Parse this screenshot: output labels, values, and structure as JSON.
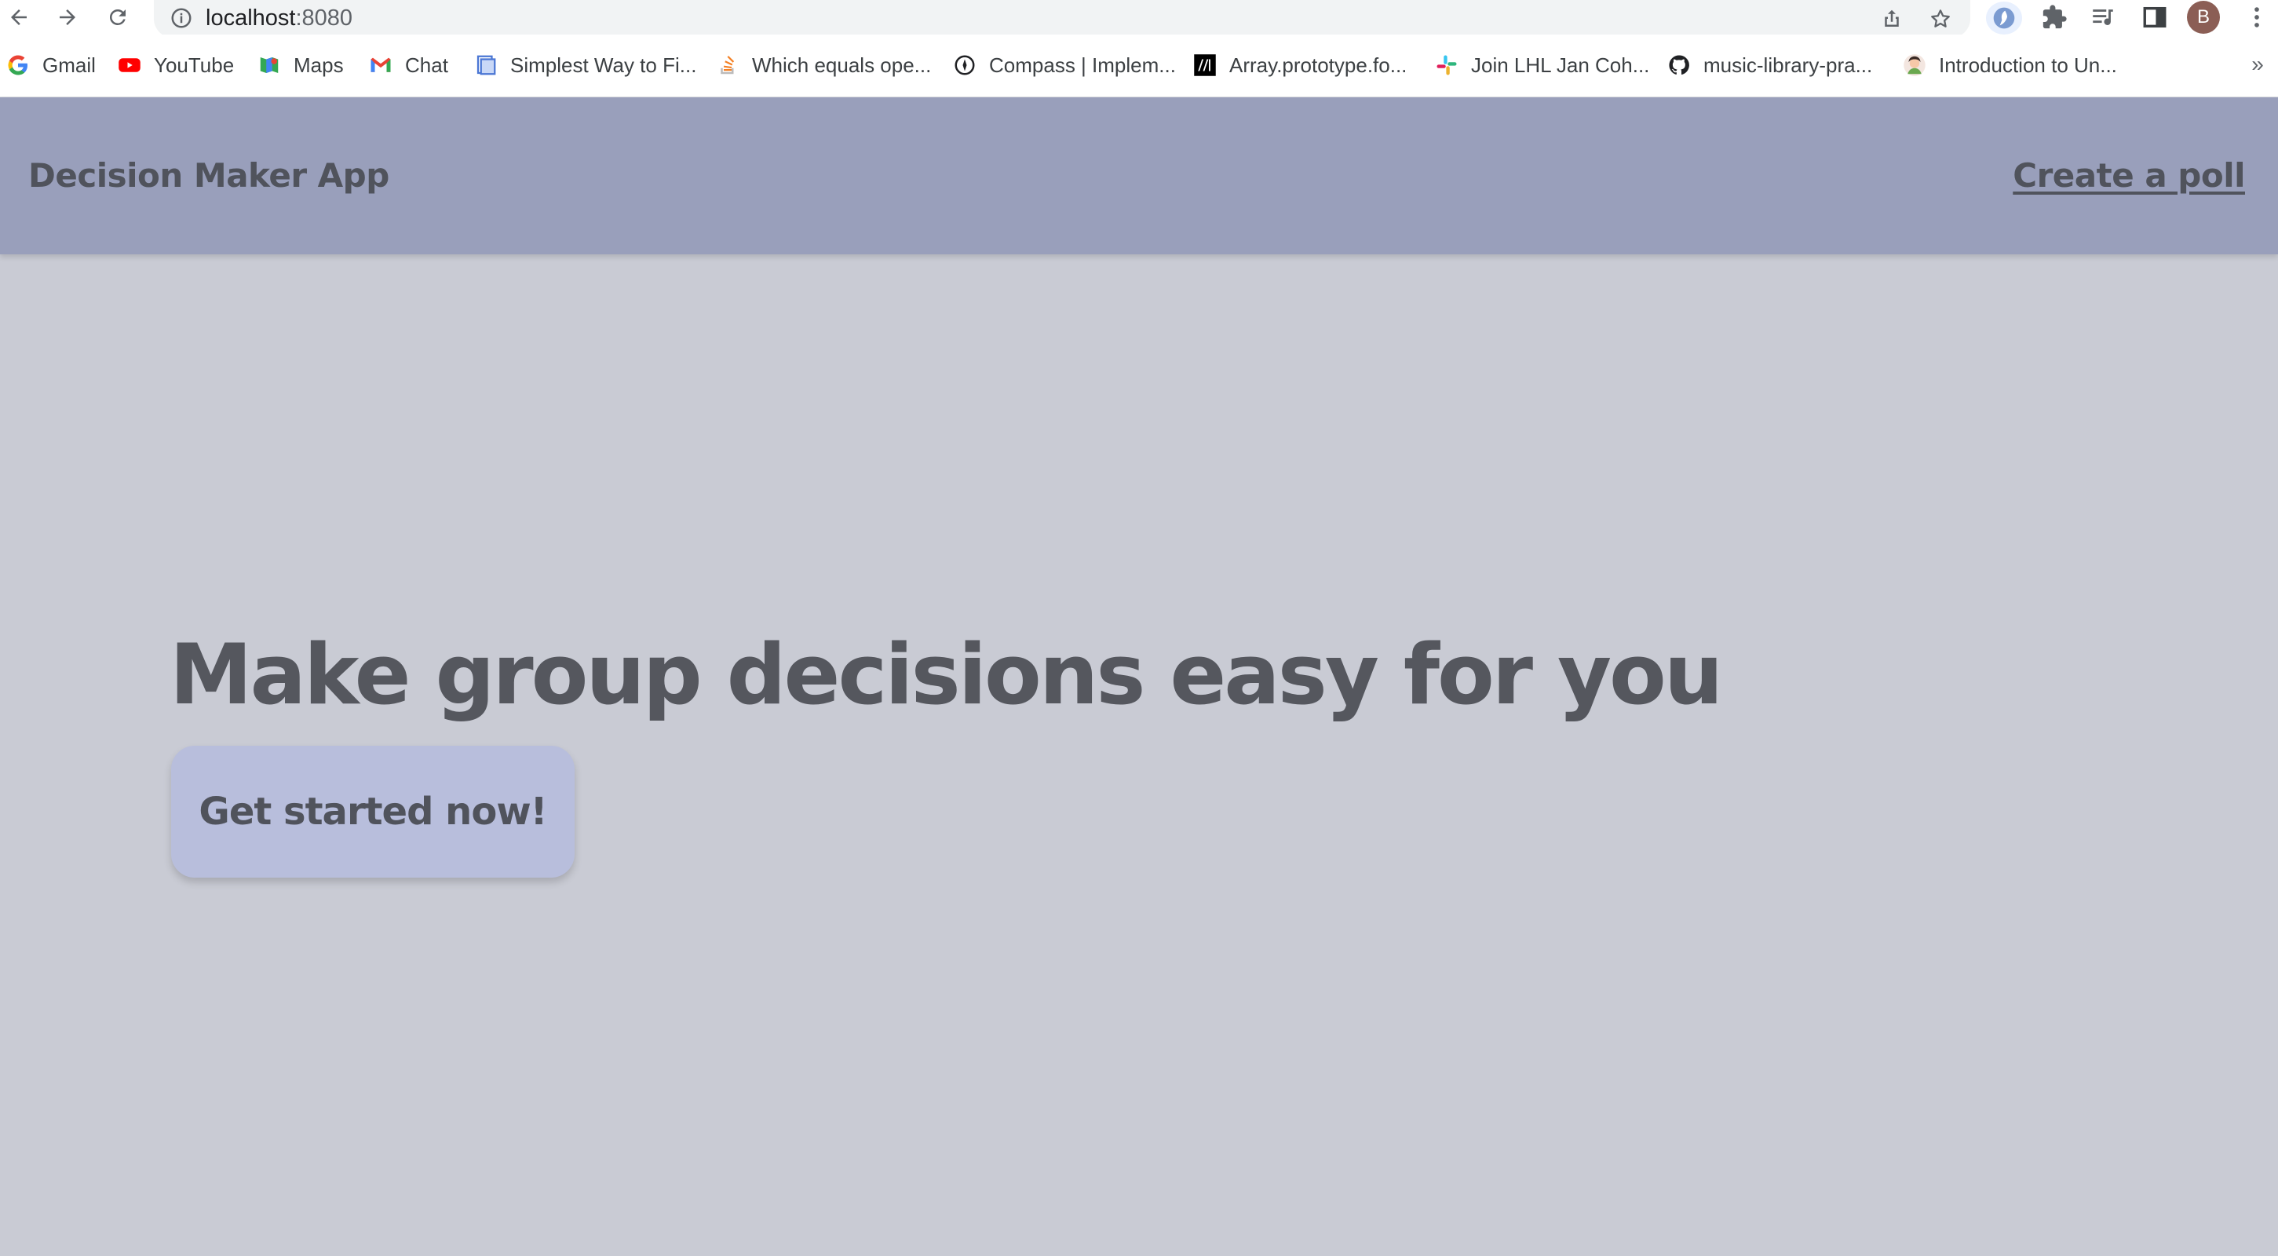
{
  "browser": {
    "url_host": "localhost",
    "url_port": ":8080",
    "profile_initial": "B"
  },
  "bookmarks": [
    {
      "label": "Gmail",
      "icon": "google-icon"
    },
    {
      "label": "YouTube",
      "icon": "youtube-icon"
    },
    {
      "label": "Maps",
      "icon": "maps-icon"
    },
    {
      "label": "Chat",
      "icon": "gmail-chat-icon"
    },
    {
      "label": "Simplest Way to Fi...",
      "icon": "document-icon"
    },
    {
      "label": "Which equals ope...",
      "icon": "stackoverflow-icon"
    },
    {
      "label": "Compass | Implem...",
      "icon": "compass-icon"
    },
    {
      "label": "Array.prototype.fo...",
      "icon": "mdn-icon"
    },
    {
      "label": "Join LHL Jan Coh...",
      "icon": "slack-icon"
    },
    {
      "label": "music-library-pra...",
      "icon": "github-icon"
    },
    {
      "label": "Introduction to Un...",
      "icon": "avatar-icon"
    }
  ],
  "bookmarks_overflow": "»",
  "app": {
    "brand": "Decision Maker App",
    "nav_link": "Create a poll",
    "hero_title": "Make group decisions easy for you",
    "cta_label": "Get started now!"
  },
  "colors": {
    "page_bg": "#c9cbd4",
    "header_bg": "#999fbb",
    "cta_bg": "#b8bedc",
    "text": "#55575e"
  }
}
